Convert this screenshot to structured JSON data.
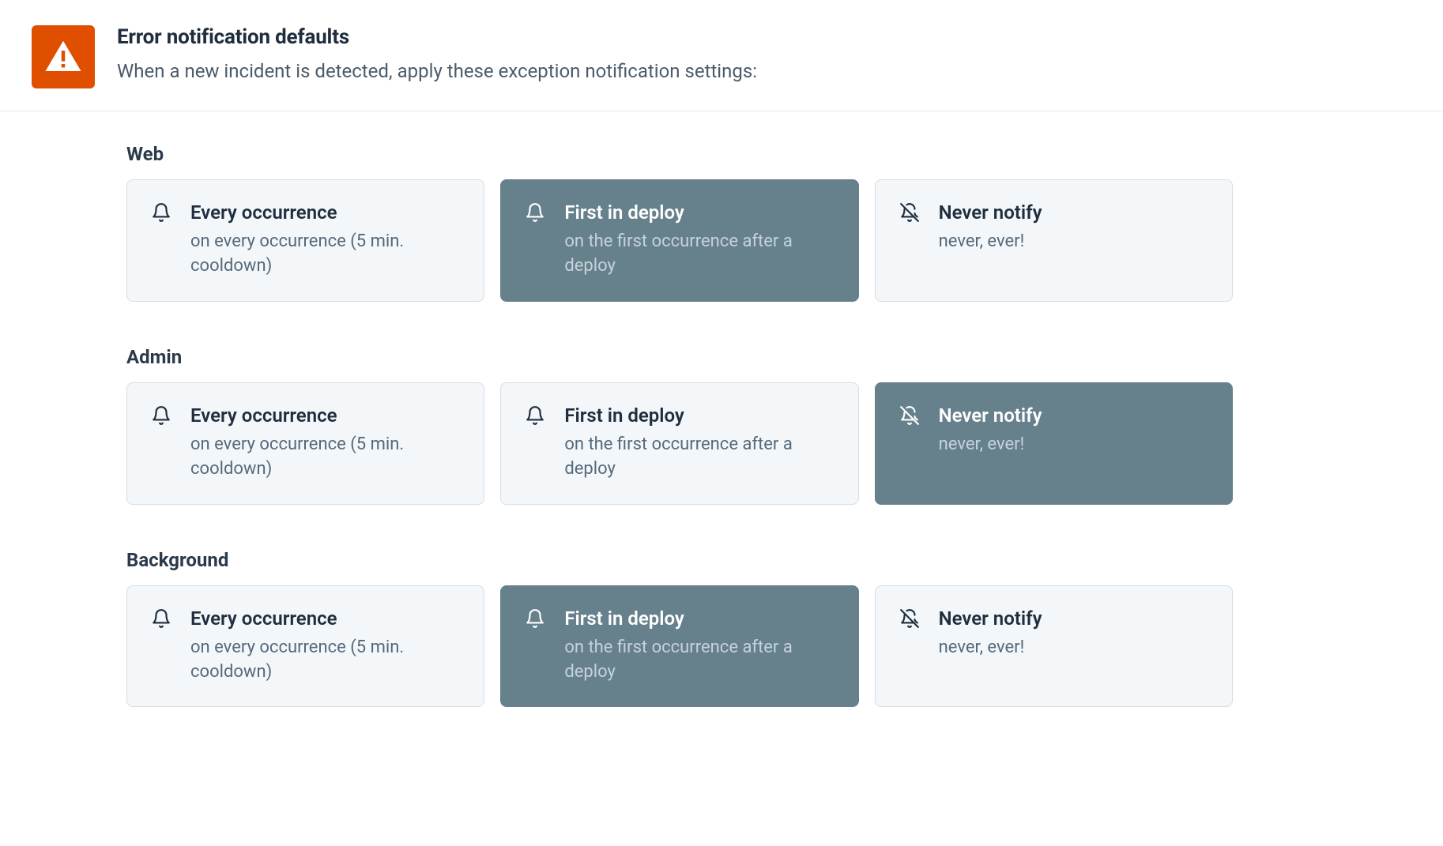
{
  "header": {
    "title": "Error notification defaults",
    "subtitle": "When a new incident is detected, apply these exception notification settings:"
  },
  "options": {
    "every": {
      "title": "Every occurrence",
      "sub": "on every occurrence (5 min. cooldown)",
      "icon": "bell"
    },
    "first": {
      "title": "First in deploy",
      "sub": "on the first occurrence after a deploy",
      "icon": "bell"
    },
    "never": {
      "title": "Never notify",
      "sub": "never, ever!",
      "icon": "bell-off"
    }
  },
  "groups": [
    {
      "key": "web",
      "label": "Web",
      "selected": "first"
    },
    {
      "key": "admin",
      "label": "Admin",
      "selected": "never"
    },
    {
      "key": "background",
      "label": "Background",
      "selected": "first"
    }
  ]
}
